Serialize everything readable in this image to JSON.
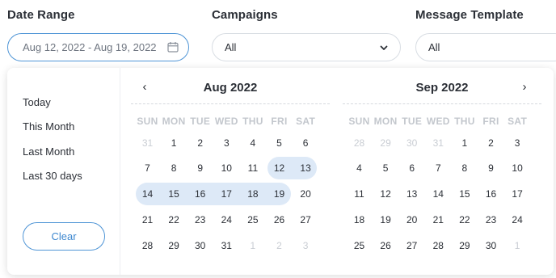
{
  "filters": {
    "date_range": {
      "label": "Date Range",
      "value": "Aug 12, 2022 - Aug 19, 2022"
    },
    "campaigns": {
      "label": "Campaigns",
      "value": "All"
    },
    "message_template": {
      "label": "Message Template",
      "value": "All"
    }
  },
  "presets": [
    "Today",
    "This Month",
    "Last Month",
    "Last 30 days"
  ],
  "clear_label": "Clear",
  "nav": {
    "prev": "‹",
    "next": "›"
  },
  "weekdays": [
    "SUN",
    "MON",
    "TUE",
    "WED",
    "THU",
    "FRI",
    "SAT"
  ],
  "calendars": [
    {
      "title": "Aug 2022",
      "weeks": [
        [
          [
            "31",
            true
          ],
          [
            "1",
            false
          ],
          [
            "2",
            false
          ],
          [
            "3",
            false
          ],
          [
            "4",
            false
          ],
          [
            "5",
            false
          ],
          [
            "6",
            false
          ]
        ],
        [
          [
            "7",
            false
          ],
          [
            "8",
            false
          ],
          [
            "9",
            false
          ],
          [
            "10",
            false
          ],
          [
            "11",
            false
          ],
          [
            "12",
            false
          ],
          [
            "13",
            false
          ]
        ],
        [
          [
            "14",
            false
          ],
          [
            "15",
            false
          ],
          [
            "16",
            false
          ],
          [
            "17",
            false
          ],
          [
            "18",
            false
          ],
          [
            "19",
            false
          ],
          [
            "20",
            false
          ]
        ],
        [
          [
            "21",
            false
          ],
          [
            "22",
            false
          ],
          [
            "23",
            false
          ],
          [
            "24",
            false
          ],
          [
            "25",
            false
          ],
          [
            "26",
            false
          ],
          [
            "27",
            false
          ]
        ],
        [
          [
            "28",
            false
          ],
          [
            "29",
            false
          ],
          [
            "30",
            false
          ],
          [
            "31",
            false
          ],
          [
            "1",
            true
          ],
          [
            "2",
            true
          ],
          [
            "3",
            true
          ]
        ]
      ]
    },
    {
      "title": "Sep 2022",
      "weeks": [
        [
          [
            "28",
            true
          ],
          [
            "29",
            true
          ],
          [
            "30",
            true
          ],
          [
            "31",
            true
          ],
          [
            "1",
            false
          ],
          [
            "2",
            false
          ],
          [
            "3",
            false
          ]
        ],
        [
          [
            "4",
            false
          ],
          [
            "5",
            false
          ],
          [
            "6",
            false
          ],
          [
            "7",
            false
          ],
          [
            "8",
            false
          ],
          [
            "9",
            false
          ],
          [
            "10",
            false
          ]
        ],
        [
          [
            "11",
            false
          ],
          [
            "12",
            false
          ],
          [
            "13",
            false
          ],
          [
            "14",
            false
          ],
          [
            "15",
            false
          ],
          [
            "16",
            false
          ],
          [
            "17",
            false
          ]
        ],
        [
          [
            "18",
            false
          ],
          [
            "19",
            false
          ],
          [
            "20",
            false
          ],
          [
            "21",
            false
          ],
          [
            "22",
            false
          ],
          [
            "23",
            false
          ],
          [
            "24",
            false
          ]
        ],
        [
          [
            "25",
            false
          ],
          [
            "26",
            false
          ],
          [
            "27",
            false
          ],
          [
            "28",
            false
          ],
          [
            "29",
            false
          ],
          [
            "30",
            false
          ],
          [
            "1",
            true
          ]
        ]
      ]
    }
  ],
  "selection": {
    "start": "Aug 12, 2022",
    "end": "Aug 19, 2022"
  },
  "colors": {
    "accent": "#4f95d6",
    "range_fill": "#dde9f7",
    "muted_text": "#c9cdd3"
  }
}
